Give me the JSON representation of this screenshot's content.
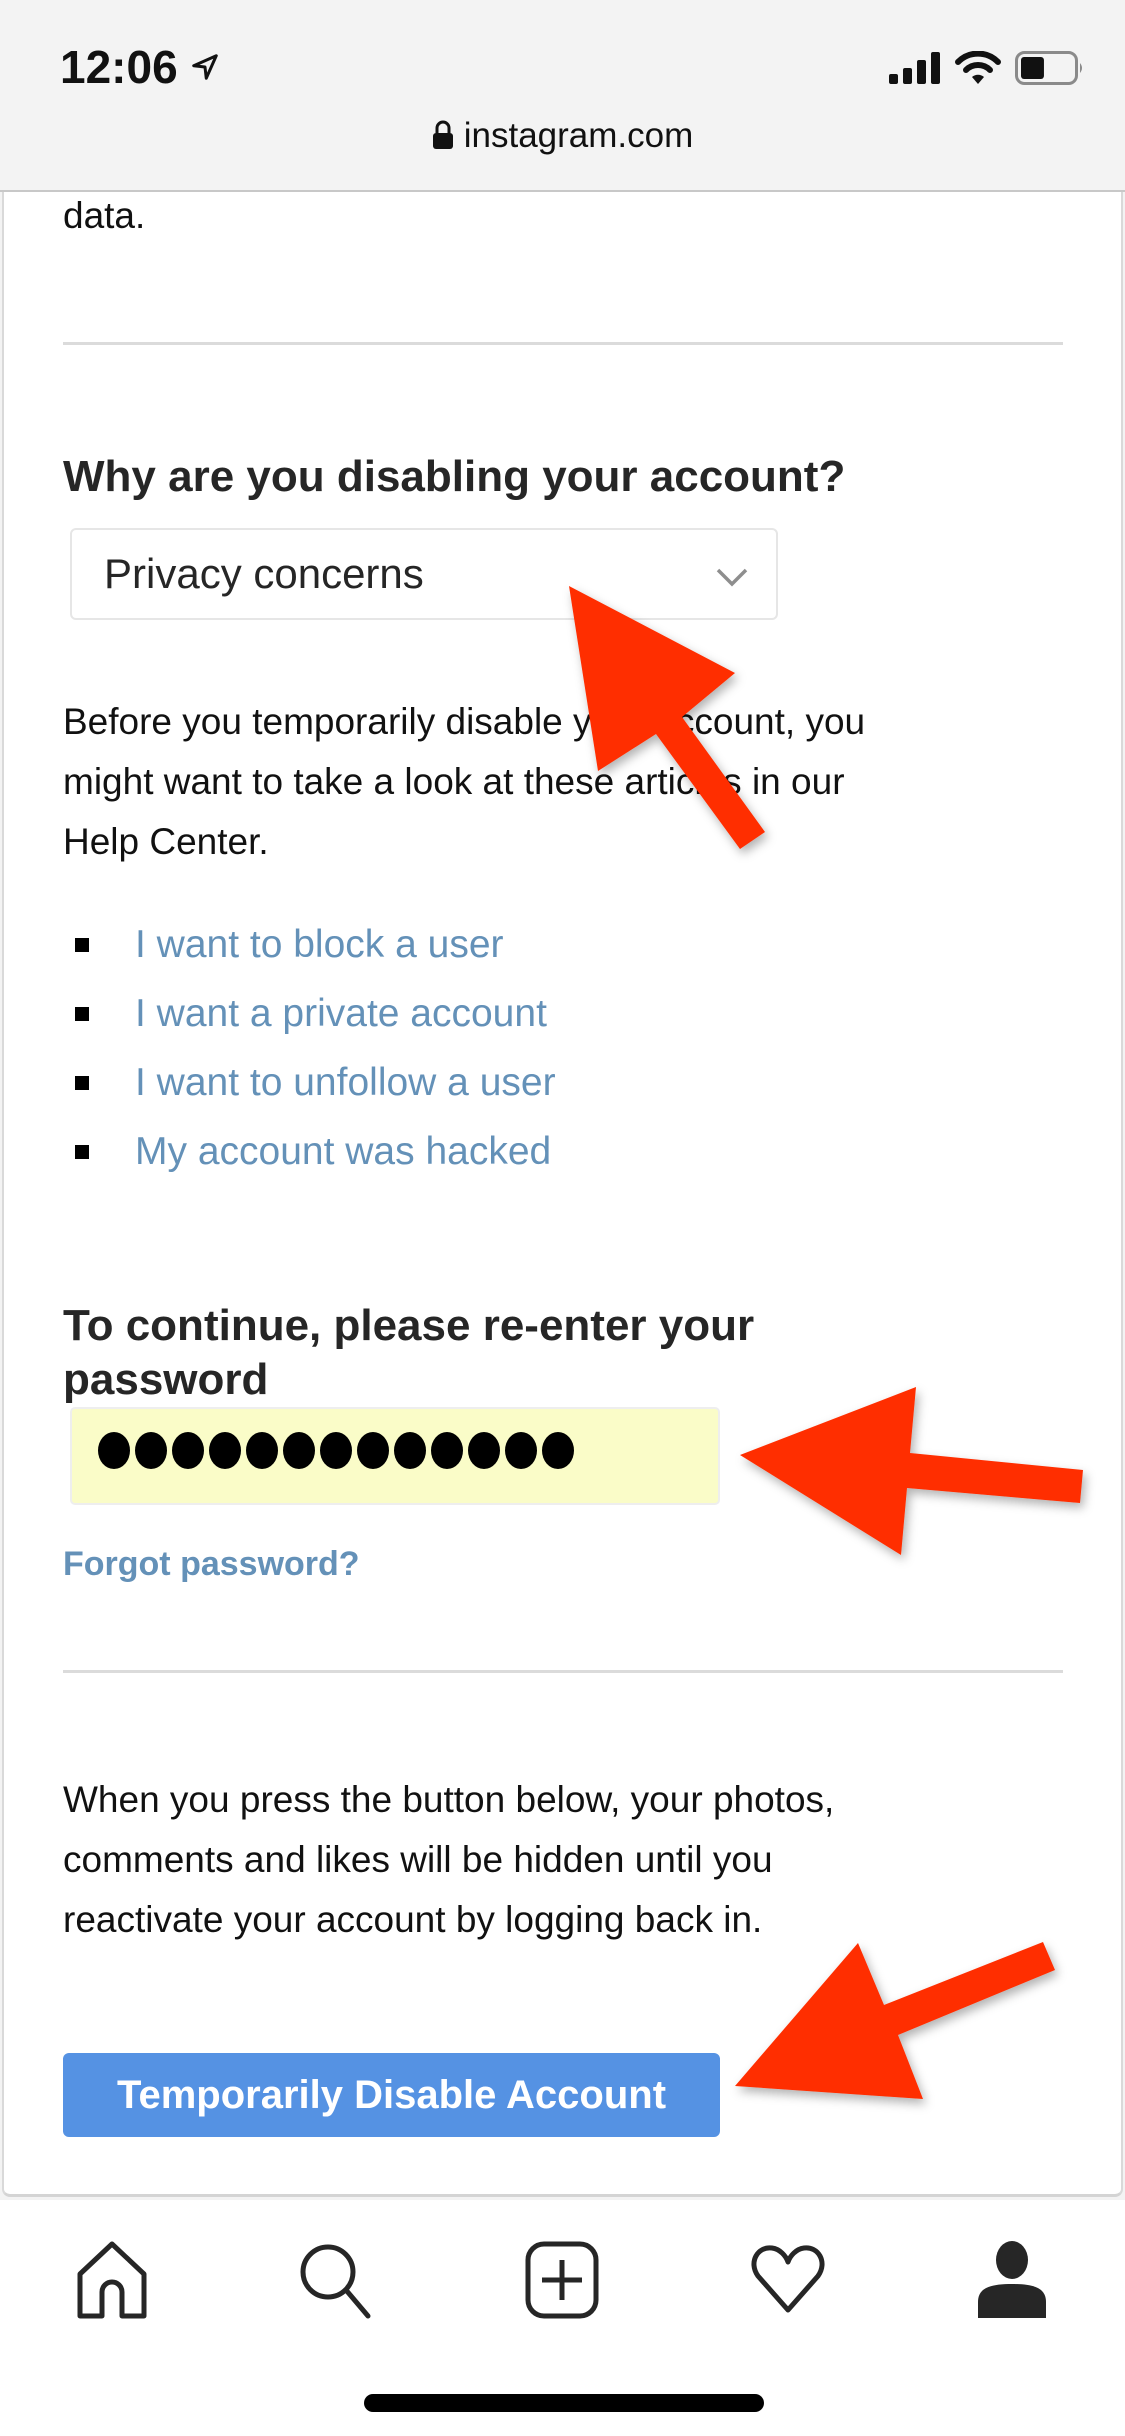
{
  "status_bar": {
    "time": "12:06",
    "location_icon": "location-arrow-icon",
    "signal_icon": "cellular-signal-icon",
    "wifi_icon": "wifi-icon",
    "battery_icon": "battery-icon",
    "battery_level_percent": 45
  },
  "browser": {
    "lock_icon": "lock-icon",
    "url": "instagram.com"
  },
  "page": {
    "truncated_text": "data.",
    "reason_heading": "Why are you disabling your account?",
    "reason_select": {
      "selected": "Privacy concerns",
      "icon": "chevron-down-icon"
    },
    "help_paragraph": [
      "Before you temporarily disable your account, you",
      "might want to take a look at these articles in our",
      "Help Center."
    ],
    "help_links": [
      "I want to block a user",
      "I want a private account",
      "I want to unfollow a user",
      "My account was hacked"
    ],
    "password_heading": [
      "To continue, please re-enter your",
      "password"
    ],
    "password_value_masked": "●●●●●●●●●●●●●",
    "password_length": 13,
    "forgot_password": "Forgot password?",
    "info_paragraph": [
      "When you press the button below, your photos,",
      "comments and likes will be hidden until you",
      "reactivate your account by logging back in."
    ],
    "disable_button": "Temporarily Disable Account"
  },
  "colors": {
    "link": "#6491b8",
    "button": "#5592e3",
    "password_autofill_bg": "#fafcc8",
    "annotation_arrow": "#ff2d00"
  },
  "tab_bar": [
    {
      "name": "home",
      "icon": "home-icon"
    },
    {
      "name": "search",
      "icon": "search-icon"
    },
    {
      "name": "new-post",
      "icon": "plus-square-icon"
    },
    {
      "name": "activity",
      "icon": "heart-icon"
    },
    {
      "name": "profile",
      "icon": "profile-icon"
    }
  ]
}
